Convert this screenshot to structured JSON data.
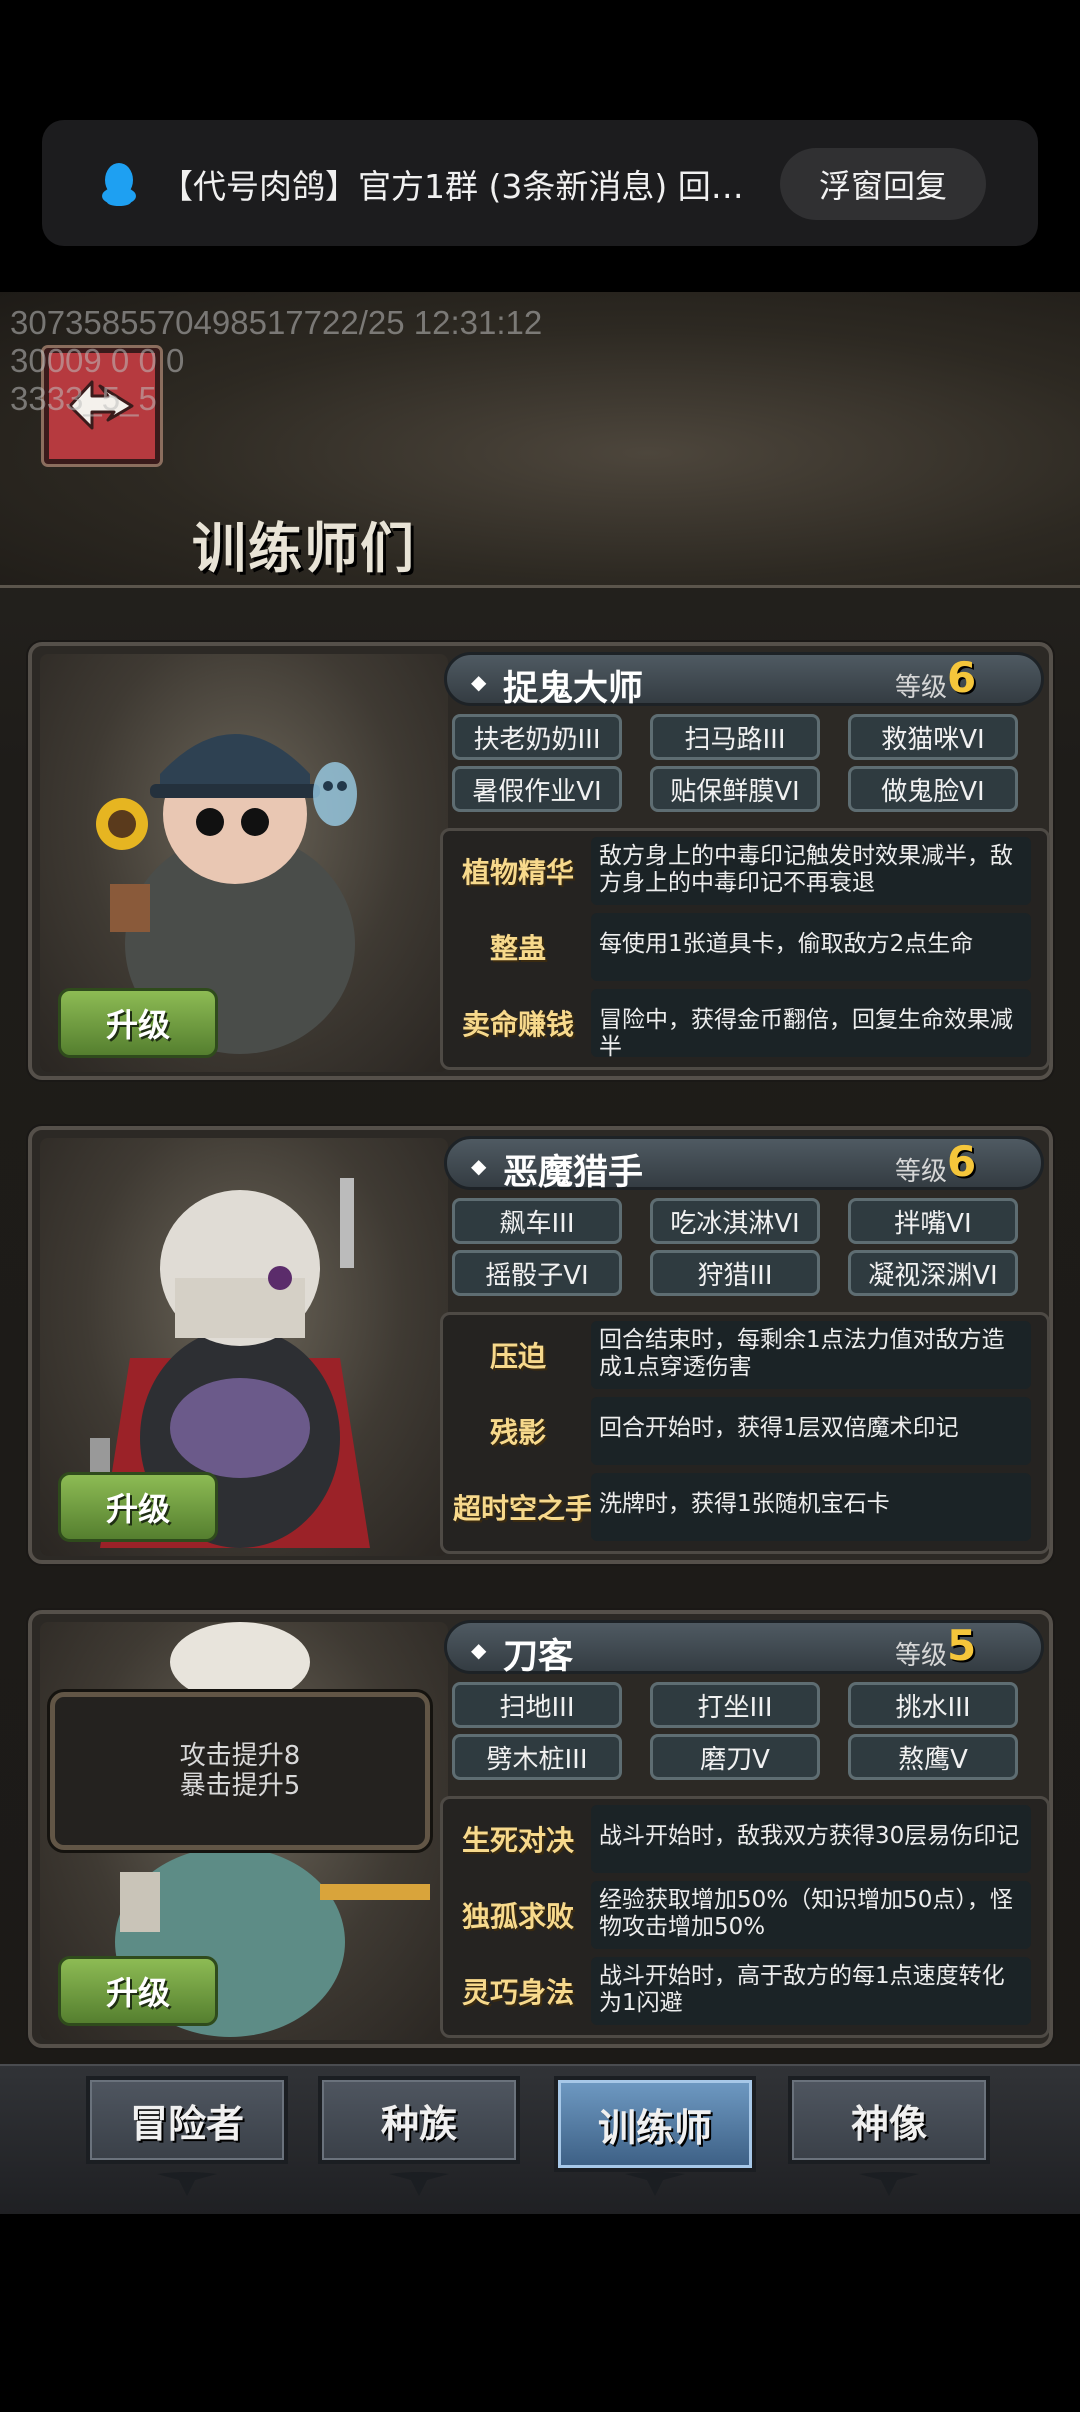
{
  "notification": {
    "message": "【代号肉鸽】官方1群 (3条新消息) 回…",
    "reply_label": "浮窗回复",
    "icon": "qq-penguin-icon"
  },
  "debug": {
    "line1": "3073585570498517722/25 12:31:12",
    "line2": "30009 0 0 0",
    "line3": "3333_5_5"
  },
  "header": {
    "title": "训练师们",
    "back_icon": "back-arrow-icon"
  },
  "level_label": "等级",
  "upgrade_label": "升级",
  "trainers": [
    {
      "name": "捉鬼大师",
      "level": "6",
      "tags": [
        "扶老奶奶III",
        "扫马路III",
        "救猫咪VI",
        "暑假作业VI",
        "贴保鲜膜VI",
        "做鬼脸VI"
      ],
      "skills": [
        {
          "name": "植物精华",
          "desc": "敌方身上的中毒印记触发时效果减半，敌方身上的中毒印记不再衰退"
        },
        {
          "name": "整蛊",
          "desc": "每使用1张道具卡，偷取敌方2点生命"
        },
        {
          "name": "卖命赚钱",
          "desc": "冒险中，获得金币翻倍，回复生命效果减半"
        }
      ]
    },
    {
      "name": "恶魔猎手",
      "level": "6",
      "tags": [
        "飙车III",
        "吃冰淇淋VI",
        "拌嘴VI",
        "摇骰子VI",
        "狩猎III",
        "凝视深渊VI"
      ],
      "skills": [
        {
          "name": "压迫",
          "desc": "回合结束时，每剩余1点法力值对敌方造成1点穿透伤害"
        },
        {
          "name": "残影",
          "desc": "回合开始时，获得1层双倍魔术印记"
        },
        {
          "name": "超时空之手",
          "desc": "洗牌时，获得1张随机宝石卡"
        }
      ]
    },
    {
      "name": "刀客",
      "level": "5",
      "tags": [
        "扫地III",
        "打坐III",
        "挑水III",
        "劈木桩III",
        "磨刀V",
        "熬鹰V"
      ],
      "skills": [
        {
          "name": "生死对决",
          "desc": "战斗开始时，敌我双方获得30层易伤印记"
        },
        {
          "name": "独孤求败",
          "desc": "经验获取增加50%（知识增加50点），怪物攻击增加50%"
        },
        {
          "name": "灵巧身法",
          "desc": "战斗开始时，高于敌方的每1点速度转化为1闪避"
        }
      ],
      "buff_popup": {
        "line1": "攻击提升8",
        "line2": "暴击提升5"
      }
    }
  ],
  "tabs": [
    {
      "label": "冒险者",
      "active": false
    },
    {
      "label": "种族",
      "active": false
    },
    {
      "label": "训练师",
      "active": true
    },
    {
      "label": "神像",
      "active": false
    }
  ]
}
